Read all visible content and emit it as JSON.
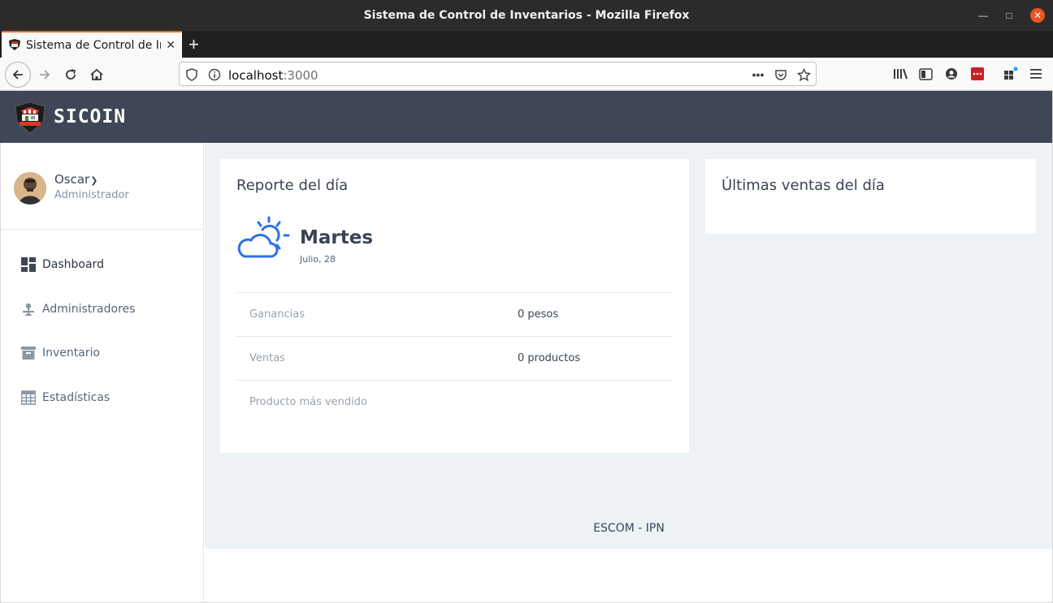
{
  "window": {
    "title": "Sistema de Control de Inventarios - Mozilla Firefox",
    "minimize_icon": "minimize-icon",
    "maximize_icon": "maximize-icon",
    "close_icon": "close-icon"
  },
  "browser": {
    "tab_title": "Sistema de Control de Inventarios",
    "new_tab_label": "+",
    "url_host": "localhost",
    "url_port": ":3000",
    "url_menu": "•••"
  },
  "app": {
    "name": "SICOIN",
    "brand_color": "#3f4756",
    "accent_color": "#2f6fe8"
  },
  "user": {
    "name": "Oscar",
    "role": "Administrador"
  },
  "sidebar": {
    "items": [
      {
        "label": "Dashboard",
        "icon": "dashboard-icon"
      },
      {
        "label": "Administradores",
        "icon": "admin-user-icon"
      },
      {
        "label": "Inventario",
        "icon": "archive-box-icon"
      },
      {
        "label": "Estadísticas",
        "icon": "table-grid-icon"
      }
    ]
  },
  "report": {
    "title": "Reporte del día",
    "weather_icon": "partly-cloudy-icon",
    "day": "Martes",
    "date": "Julio, 28",
    "rows": [
      {
        "label": "Ganancias",
        "value": "0 pesos"
      },
      {
        "label": "Ventas",
        "value": "0 productos"
      },
      {
        "label": "Producto más vendido",
        "value": ""
      }
    ]
  },
  "sales": {
    "title": "Últimas ventas del día"
  },
  "footer": {
    "text": "ESCOM - IPN"
  }
}
